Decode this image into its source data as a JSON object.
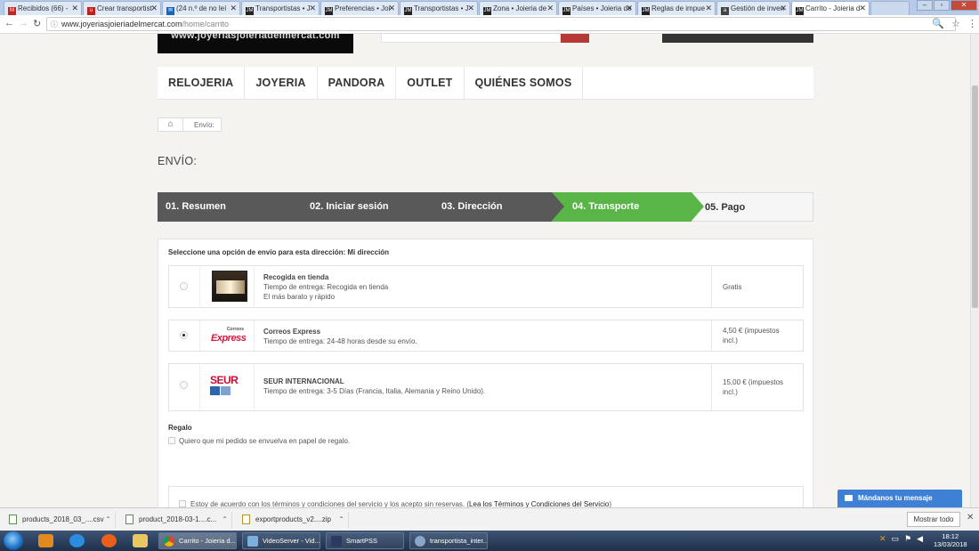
{
  "browser": {
    "tabs": [
      {
        "label": "Recibidos (66) - ",
        "icon": "gmail-icon",
        "active": false
      },
      {
        "label": "Crear transportist",
        "icon": "u-icon",
        "active": false
      },
      {
        "label": "(24 n.º de no leí",
        "icon": "inbox-icon",
        "active": false
      },
      {
        "label": "Transportistas • J",
        "icon": "jm-icon",
        "active": false
      },
      {
        "label": "Preferencias • Joi",
        "icon": "jm-icon",
        "active": false
      },
      {
        "label": "Transportistas • J",
        "icon": "jm-icon",
        "active": false
      },
      {
        "label": "Zona • Joieria de",
        "icon": "jm-icon",
        "active": false
      },
      {
        "label": "Países • Joieria de",
        "icon": "jm-icon",
        "active": false
      },
      {
        "label": "Reglas de impue",
        "icon": "jm-icon",
        "active": false
      },
      {
        "label": "Gestión de inven",
        "icon": "a-icon",
        "active": false
      },
      {
        "label": "Carrito - Joieria d",
        "icon": "jm-icon",
        "active": true
      }
    ],
    "url_host": "www.joyeriasjoieriadelmercat.com",
    "url_path": "/home/carrito"
  },
  "site": {
    "logo_text": "www.joyeriasjoieriadelmercat.com",
    "nav": [
      "RELOJERIA",
      "JOYERIA",
      "PANDORA",
      "OUTLET",
      "QUIÉNES SOMOS"
    ],
    "breadcrumb_current": "Envío:",
    "page_title": "ENVÍO:"
  },
  "steps": [
    {
      "label": "01. Resumen",
      "state": "done"
    },
    {
      "label": "02. Iniciar sesión",
      "state": "done"
    },
    {
      "label": "03. Dirección",
      "state": "done"
    },
    {
      "label": "04. Transporte",
      "state": "current"
    },
    {
      "label": "05. Pago",
      "state": "todo"
    }
  ],
  "shipping": {
    "heading": "Seleccione una opción de envío para esta dirección: Mi dirección",
    "options": [
      {
        "name": "Recogida en tienda",
        "delivery": "Tiempo de entrega: Recogida en tienda",
        "note": "El más barato y rápido",
        "price": "Gratis",
        "selected": false
      },
      {
        "name": "Correos Express",
        "delivery": "Tiempo de entrega: 24-48 horas desde su envío.",
        "note": "",
        "price": "4,50 € (impuestos incl.)",
        "selected": true,
        "logo_small": "Correos",
        "logo_big": "Express"
      },
      {
        "name": "SEUR INTERNACIONAL",
        "delivery": "Tiempo de entrega: 3-5 Días (Francia, Italia, Alemania y Reino Unido).",
        "note": "",
        "price": "15,00 € (impuestos incl.)",
        "selected": false,
        "logo_text": "SEUR"
      }
    ]
  },
  "gift": {
    "title": "Regalo",
    "label": "Quiero que mi pedido se envuelva en papel de regalo."
  },
  "terms": {
    "label": "Estoy de acuerdo con los términos y condiciones del servicio y los acepto sin reservas. (",
    "link": "Lea los Términos y Condiciones del Servicio",
    "close": ")"
  },
  "chat_label": "Mándanos tu mensaje",
  "downloads": {
    "items": [
      "products_2018_03_....csv",
      "product_2018-03-1....c...",
      "exportproducts_v2....zip"
    ],
    "show_all": "Mostrar todo"
  },
  "taskbar": {
    "tasks": [
      "Carrito - Joieria d...",
      "VideoServer - Vid...",
      "SmartPSS",
      "transportista_inter..."
    ],
    "time": "18:12",
    "date": "13/03/2018"
  },
  "colors": {
    "step_done": "#595959",
    "step_current": "#59b548",
    "chat": "#3d80d6"
  }
}
